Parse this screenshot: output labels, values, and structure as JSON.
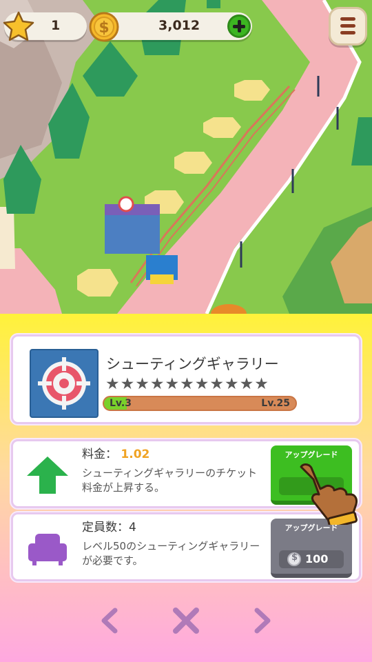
{
  "hud": {
    "stars": "1",
    "coins": "3,012",
    "icons": [
      "star-icon",
      "coin-icon",
      "plus-icon",
      "menu-icon"
    ]
  },
  "attraction": {
    "name": "シューティングギャラリー",
    "stars_total": 11,
    "stars_filled": 0,
    "level_current": "Lv.3",
    "level_max": "Lv.25",
    "level_progress": 0.12,
    "icon": "target-icon"
  },
  "fee_row": {
    "title": "料金：",
    "value": "1.02",
    "description": "シューティングギャラリーのチケット料金が上昇する。",
    "icon": "arrow-up-icon",
    "button_label": "アップグレード",
    "button_state": "enabled"
  },
  "capacity_row": {
    "title": "定員数：4",
    "description": "レベル50のシューティングギャラリーが必要です。",
    "icon": "seat-icon",
    "button_label": "アップグレード",
    "button_price": "100",
    "button_state": "disabled"
  },
  "nav": {
    "icons": [
      "chevron-left-icon",
      "close-icon",
      "chevron-right-icon"
    ]
  },
  "colors": {
    "accent_green": "#3dbe21",
    "value_orange": "#f0a323",
    "disabled_gray": "#7b7b86",
    "nav_purple": "#b07ab8"
  }
}
